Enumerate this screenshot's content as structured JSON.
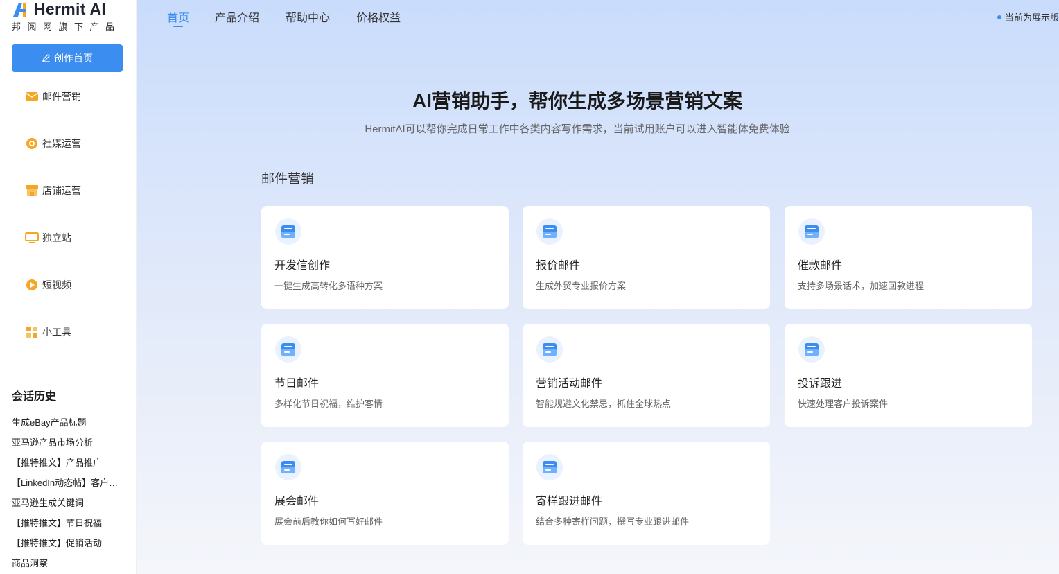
{
  "brand": {
    "name": "Hermit AI",
    "subtitle": "邦阅网旗下产品",
    "accent": "#3b8ef0"
  },
  "sidebar": {
    "create_button": "创作首页",
    "items": [
      {
        "label": "邮件营销",
        "icon": "mail-icon"
      },
      {
        "label": "社媒运营",
        "icon": "social-icon"
      },
      {
        "label": "店铺运营",
        "icon": "store-icon"
      },
      {
        "label": "独立站",
        "icon": "monitor-icon"
      },
      {
        "label": "短视频",
        "icon": "video-icon"
      },
      {
        "label": "小工具",
        "icon": "tools-icon"
      }
    ],
    "history_title": "会话历史",
    "history": [
      "生成eBay产品标题",
      "亚马逊产品市场分析",
      "【推特推文】产品推广",
      "【LinkedIn动态帖】客户案例分享",
      "亚马逊生成关键词",
      "【推特推文】节日祝福",
      "【推特推文】促销活动",
      "商品洞察"
    ]
  },
  "topnav": {
    "tabs": [
      "首页",
      "产品介绍",
      "帮助中心",
      "价格权益"
    ],
    "active_tab": "首页",
    "demo_note": "当前为展示版"
  },
  "hero": {
    "title": "AI营销助手，帮你生成多场景营销文案",
    "subtitle": "HermitAI可以帮你完成日常工作中各类内容写作需求，当前试用账户可以进入智能体免费体验"
  },
  "section": {
    "title": "邮件营销",
    "cards": [
      {
        "title": "开发信创作",
        "desc": "一键生成高转化多语种方案"
      },
      {
        "title": "报价邮件",
        "desc": "生成外贸专业报价方案"
      },
      {
        "title": "催款邮件",
        "desc": "支持多场景话术，加速回款进程"
      },
      {
        "title": "节日邮件",
        "desc": "多样化节日祝福，维护客情"
      },
      {
        "title": "营销活动邮件",
        "desc": "智能规避文化禁忌，抓住全球热点"
      },
      {
        "title": "投诉跟进",
        "desc": "快速处理客户投诉案件"
      },
      {
        "title": "展会邮件",
        "desc": "展会前后教你如何写好邮件"
      },
      {
        "title": "寄样跟进邮件",
        "desc": "结合多种寄样问题，撰写专业跟进邮件"
      }
    ]
  }
}
